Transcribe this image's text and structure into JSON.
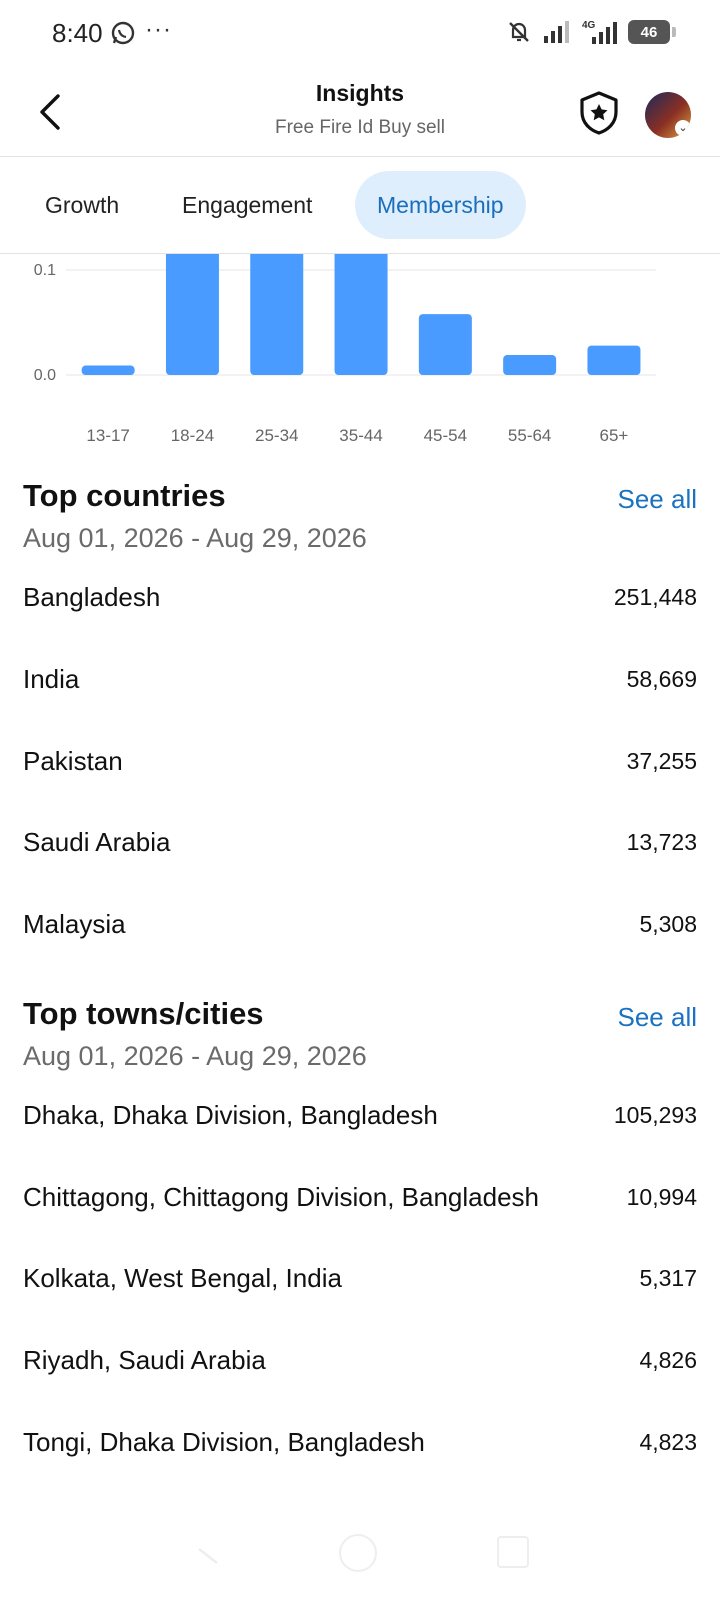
{
  "status_bar": {
    "time": "8:40",
    "dots": "···",
    "battery": "46"
  },
  "header": {
    "title": "Insights",
    "subtitle": "Free Fire Id Buy sell"
  },
  "tabs": [
    {
      "label": "Growth",
      "active": false
    },
    {
      "label": "Engagement",
      "active": false
    },
    {
      "label": "Membership",
      "active": true
    }
  ],
  "chart_data": {
    "type": "bar",
    "categories": [
      "13-17",
      "18-24",
      "25-34",
      "35-44",
      "45-54",
      "55-64",
      "65+"
    ],
    "values": [
      0.009,
      0.12,
      0.12,
      0.12,
      0.058,
      0.019,
      0.028
    ],
    "y_tick_labels": [
      "0.1",
      "0.0"
    ],
    "y_ticks": [
      0.1,
      0.0
    ],
    "ylim": [
      0,
      0.12
    ],
    "grid": true,
    "bar_color": "#4a9bff",
    "note_top_clipped": true
  },
  "top_countries": {
    "title": "Top countries",
    "see_all": "See all",
    "date_range": "Aug 01, 2026 - Aug 29, 2026",
    "items": [
      {
        "name": "Bangladesh",
        "value": "251,448"
      },
      {
        "name": "India",
        "value": "58,669"
      },
      {
        "name": "Pakistan",
        "value": "37,255"
      },
      {
        "name": "Saudi Arabia",
        "value": "13,723"
      },
      {
        "name": "Malaysia",
        "value": "5,308"
      }
    ]
  },
  "top_cities": {
    "title": "Top towns/cities",
    "see_all": "See all",
    "date_range": "Aug 01, 2026 - Aug 29, 2026",
    "items": [
      {
        "name": "Dhaka, Dhaka Division, Bangladesh",
        "value": "105,293"
      },
      {
        "name": "Chittagong, Chittagong Division, Bangladesh",
        "value": "10,994"
      },
      {
        "name": "Kolkata, West Bengal, India",
        "value": "5,317"
      },
      {
        "name": "Riyadh, Saudi Arabia",
        "value": "4,826"
      },
      {
        "name": "Tongi, Dhaka Division, Bangladesh",
        "value": "4,823"
      }
    ]
  },
  "colors": {
    "accent": "#1a72c0",
    "tab_active_bg": "#dfeefc",
    "bar": "#4a9bff"
  }
}
